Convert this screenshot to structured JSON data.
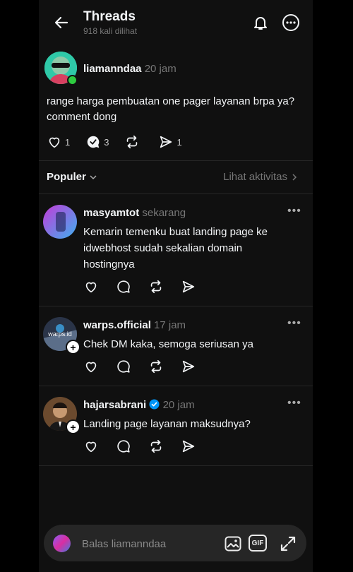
{
  "header": {
    "title": "Threads",
    "views": "918 kali dilihat",
    "icons": [
      "back-arrow-icon",
      "bell-icon",
      "more-options-icon"
    ]
  },
  "post": {
    "username": "liamanndaa",
    "time": "20 jam",
    "text": "range harga pembuatan one pager layanan brpa ya? comment dong",
    "likes": "1",
    "replies": "3",
    "shares": "1"
  },
  "sort": {
    "label": "Populer",
    "activity": "Lihat aktivitas"
  },
  "replies": [
    {
      "username": "masyamtot",
      "time": "sekarang",
      "text": "Kemarin temenku buat landing page ke idwebhost sudah sekalian domain hostingnya",
      "follow": false,
      "verified": false
    },
    {
      "username": "warps.official",
      "time": "17 jam",
      "text": "Chek DM kaka, semoga seriusan  ya",
      "follow": true,
      "verified": false,
      "avatar_text": "warps.id"
    },
    {
      "username": "hajarsabrani",
      "time": "20 jam",
      "text": "Landing page layanan maksudnya?",
      "follow": true,
      "verified": true
    }
  ],
  "composer": {
    "placeholder": "Balas liamanndaa",
    "gif_label": "GIF"
  },
  "colors": {
    "background": "#101010",
    "text": "#f3f5f7",
    "muted": "#777777",
    "verified": "#0095f6",
    "online": "#2ecc40"
  }
}
